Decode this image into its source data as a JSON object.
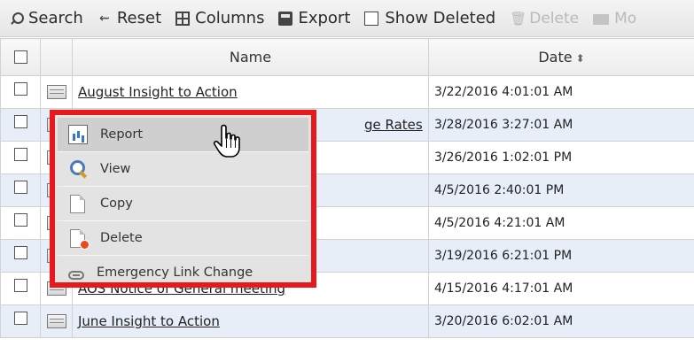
{
  "toolbar": {
    "search": "Search",
    "reset": "Reset",
    "columns": "Columns",
    "export": "Export",
    "show_deleted": "Show Deleted",
    "delete": "Delete",
    "move_partial": "Mo"
  },
  "grid": {
    "headers": {
      "name": "Name",
      "date": "Date"
    },
    "rows": [
      {
        "name": "August Insight to Action",
        "date": "3/22/2016 4:01:01 AM"
      },
      {
        "name": "ge Rates",
        "date": "3/28/2016 3:27:01 AM"
      },
      {
        "name": "",
        "date": "3/26/2016 1:02:01 PM"
      },
      {
        "name": "",
        "date": "4/5/2016 2:40:01 PM"
      },
      {
        "name": "",
        "date": "4/5/2016 4:21:01 AM"
      },
      {
        "name": "",
        "date": "3/19/2016 6:21:01 PM"
      },
      {
        "name": "AOS Notice of General meeting",
        "date": "4/15/2016 4:17:01 AM"
      },
      {
        "name": "June Insight to Action",
        "date": "3/20/2016 6:02:01 AM"
      }
    ]
  },
  "context_menu": {
    "items": [
      {
        "label": "Report",
        "icon": "report-icon"
      },
      {
        "label": "View",
        "icon": "view-icon"
      },
      {
        "label": "Copy",
        "icon": "copy-icon"
      },
      {
        "label": "Delete",
        "icon": "delete-icon"
      },
      {
        "label": "Emergency Link Change",
        "icon": "link-icon"
      }
    ],
    "highlight_color": "#e8191d"
  },
  "colors": {
    "row_alt": "#e7eef8",
    "toolbar_bg": "#eeeeee"
  }
}
